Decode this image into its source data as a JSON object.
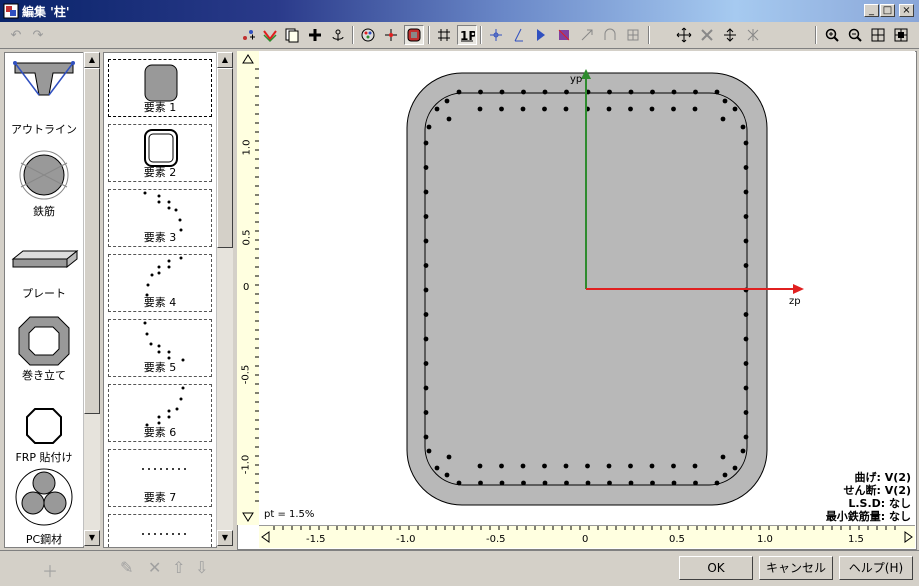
{
  "window": {
    "title": "編集 '柱'"
  },
  "window_buttons": [
    "_",
    "□",
    "×"
  ],
  "toolbar": {
    "undo": "↶",
    "redo": "↷"
  },
  "palette_items": [
    {
      "label": "アウトライン"
    },
    {
      "label": "鉄筋"
    },
    {
      "label": "プレート"
    },
    {
      "label": "巻き立て"
    },
    {
      "label": "FRP 貼付け"
    },
    {
      "label": "PC鋼材"
    }
  ],
  "elements": [
    {
      "label": "要素 1"
    },
    {
      "label": "要素 2"
    },
    {
      "label": "要素 3"
    },
    {
      "label": "要素 4"
    },
    {
      "label": "要素 5"
    },
    {
      "label": "要素 6"
    },
    {
      "label": "要素 7"
    }
  ],
  "canvas": {
    "axis_y_label": "yp",
    "axis_z_label": "zp",
    "y_ticks": [
      "1.0",
      "0.5",
      "0",
      "-0.5",
      "-1.0"
    ],
    "x_ticks": [
      "-1.5",
      "-1.0",
      "-0.5",
      "0",
      "0.5",
      "1.0",
      "1.5"
    ],
    "pt_label": "pt = 1.5%"
  },
  "info": [
    "曲げ: V(2)",
    "せん断: V(2)",
    "L.S.D: なし",
    "最小鉄筋量: なし"
  ],
  "buttons": {
    "ok": "OK",
    "cancel": "キャンセル",
    "help": "ヘルプ(H)"
  },
  "colors": {
    "section_fill": "#b8b8b8",
    "y_axis": "#2e8b2e",
    "z_axis": "#e02020",
    "ruler": "#ffffe0"
  }
}
